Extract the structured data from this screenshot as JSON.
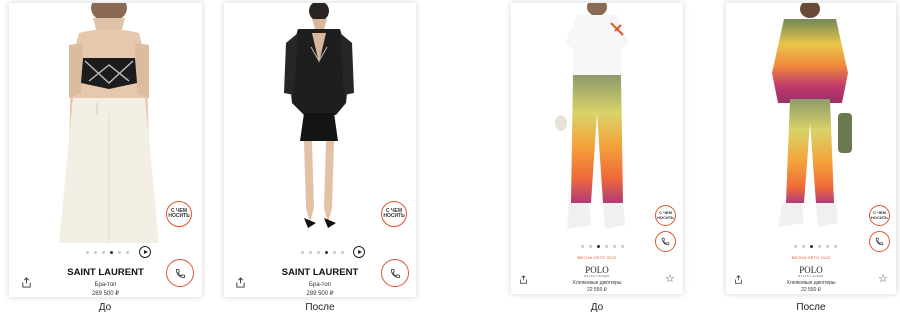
{
  "cards": [
    {
      "caption": "До",
      "brand": "SAINT LAURENT",
      "subtitle": "Бра-топ",
      "price": "289 500 ₽",
      "wear_label": "С ЧЕМ НОСИТЬ",
      "carousel": {
        "count": 6,
        "active": 3
      }
    },
    {
      "caption": "После",
      "brand": "SAINT LAURENT",
      "subtitle": "Бра-топ",
      "price": "289 500 ₽",
      "wear_label": "С ЧЕМ НОСИТЬ",
      "carousel": {
        "count": 6,
        "active": 3
      }
    },
    {
      "caption": "До",
      "badge": "ВЕСНА-ЛЕТО 2022",
      "brand": "POLO",
      "brand_sub": "RALPH LAUREN",
      "subtitle": "Хлопковые джоггеры",
      "price": "22 550 ₽",
      "wear_label": "С ЧЕМ НОСИТЬ",
      "carousel": {
        "count": 6,
        "active": 2
      }
    },
    {
      "caption": "После",
      "badge": "ВЕСНА-ЛЕТО 2022",
      "brand": "POLO",
      "brand_sub": "RALPH LAUREN",
      "subtitle": "Хлопковые джоггеры",
      "price": "22 550 ₽",
      "wear_label": "С ЧЕМ НОСИТЬ",
      "carousel": {
        "count": 6,
        "active": 2
      }
    }
  ],
  "icons": {
    "share": "share-icon",
    "phone": "phone-icon",
    "star": "star-icon",
    "play": "play-icon"
  },
  "colors": {
    "accent": "#e0552b",
    "cream": "#f3efe4",
    "black": "#1c1c1c"
  }
}
